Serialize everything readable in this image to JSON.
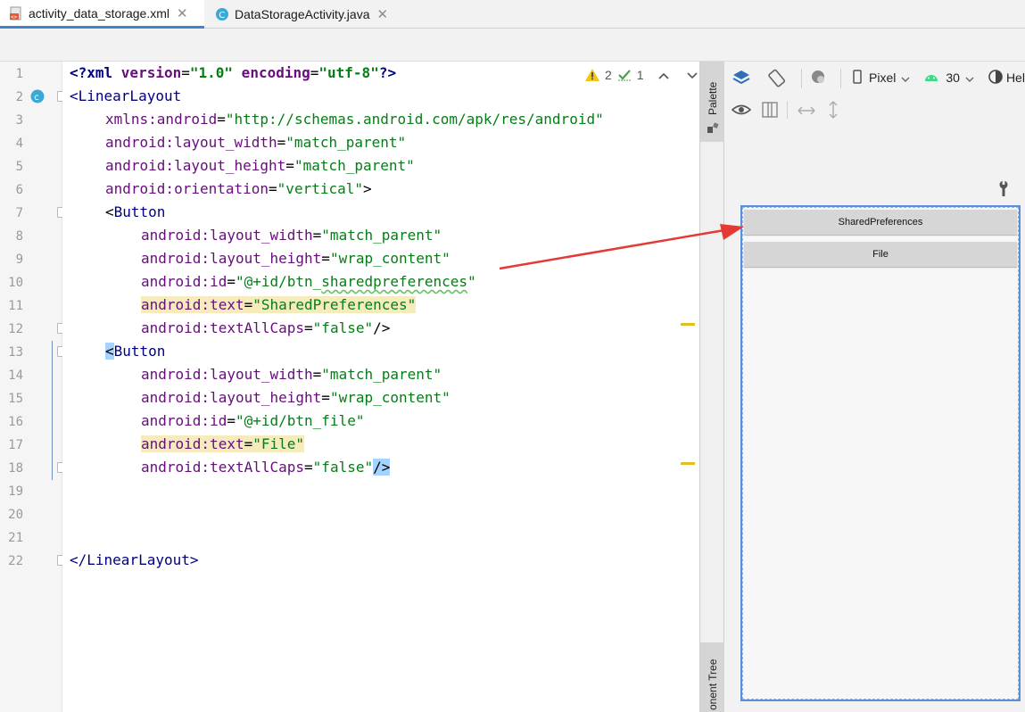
{
  "tabs": [
    {
      "label": "activity_data_storage.xml",
      "active": true,
      "icon": "xml-file-icon"
    },
    {
      "label": "DataStorageActivity.java",
      "active": false,
      "icon": "java-class-icon"
    }
  ],
  "editor": {
    "line_numbers": [
      "1",
      "2",
      "3",
      "4",
      "5",
      "6",
      "7",
      "8",
      "9",
      "10",
      "11",
      "12",
      "13",
      "14",
      "15",
      "16",
      "17",
      "18",
      "19",
      "20",
      "21",
      "22"
    ],
    "inspections": {
      "warnings": "2",
      "weak_warnings": "1"
    },
    "lines": {
      "l1": {
        "a": "<?xml ",
        "b": "version",
        "c": "=",
        "d": "\"1.0\"",
        "e": " encoding",
        "f": "=",
        "g": "\"utf-8\"",
        "h": "?>"
      },
      "l2": {
        "a": "<LinearLayout"
      },
      "l3": {
        "a": "xmlns:android",
        "b": "=",
        "c": "\"http://schemas.android.com/apk/res/android\""
      },
      "l4": {
        "a": "android:",
        "b": "layout_width",
        "c": "=",
        "d": "\"match_parent\""
      },
      "l5": {
        "a": "android:",
        "b": "layout_height",
        "c": "=",
        "d": "\"match_parent\""
      },
      "l6": {
        "a": "android:",
        "b": "orientation",
        "c": "=",
        "d": "\"vertical\"",
        "e": ">"
      },
      "l7": {
        "a": "<",
        "b": "Button"
      },
      "l8": {
        "a": "android:",
        "b": "layout_width",
        "c": "=",
        "d": "\"match_parent\""
      },
      "l9": {
        "a": "android:",
        "b": "layout_height",
        "c": "=",
        "d": "\"wrap_content\""
      },
      "l10": {
        "a": "android:",
        "b": "id",
        "c": "=",
        "d": "\"@+id/btn_",
        "e": "sharedpreferences",
        "f": "\""
      },
      "l11": {
        "a": "android:",
        "b": "text",
        "c": "=",
        "d": "\"SharedPreferences\""
      },
      "l12": {
        "a": "android:",
        "b": "textAllCaps",
        "c": "=",
        "d": "\"false\"",
        "e": "/>"
      },
      "l13": {
        "a": "<",
        "b": "Button"
      },
      "l14": {
        "a": "android:",
        "b": "layout_width",
        "c": "=",
        "d": "\"match_parent\""
      },
      "l15": {
        "a": "android:",
        "b": "layout_height",
        "c": "=",
        "d": "\"wrap_content\""
      },
      "l16": {
        "a": "android:",
        "b": "id",
        "c": "=",
        "d": "\"@+id/btn_file\""
      },
      "l17": {
        "a": "android:",
        "b": "text",
        "c": "=",
        "d": "\"File\""
      },
      "l18": {
        "a": "android:",
        "b": "textAllCaps",
        "c": "=",
        "d": "\"false\"",
        "e": "/>"
      },
      "l22": {
        "a": "</LinearLayout>"
      }
    }
  },
  "side_strip": {
    "palette": "Palette",
    "component_tree": "onent Tree"
  },
  "design": {
    "device": "Pixel",
    "api_level": "30",
    "theme_partial": "Hel",
    "preview_buttons": [
      "SharedPreferences",
      "File"
    ]
  },
  "colors": {
    "accent": "#4083c9",
    "arrow": "#e53935",
    "attr": "#660e7a",
    "value": "#067d17",
    "tag": "#000080"
  }
}
